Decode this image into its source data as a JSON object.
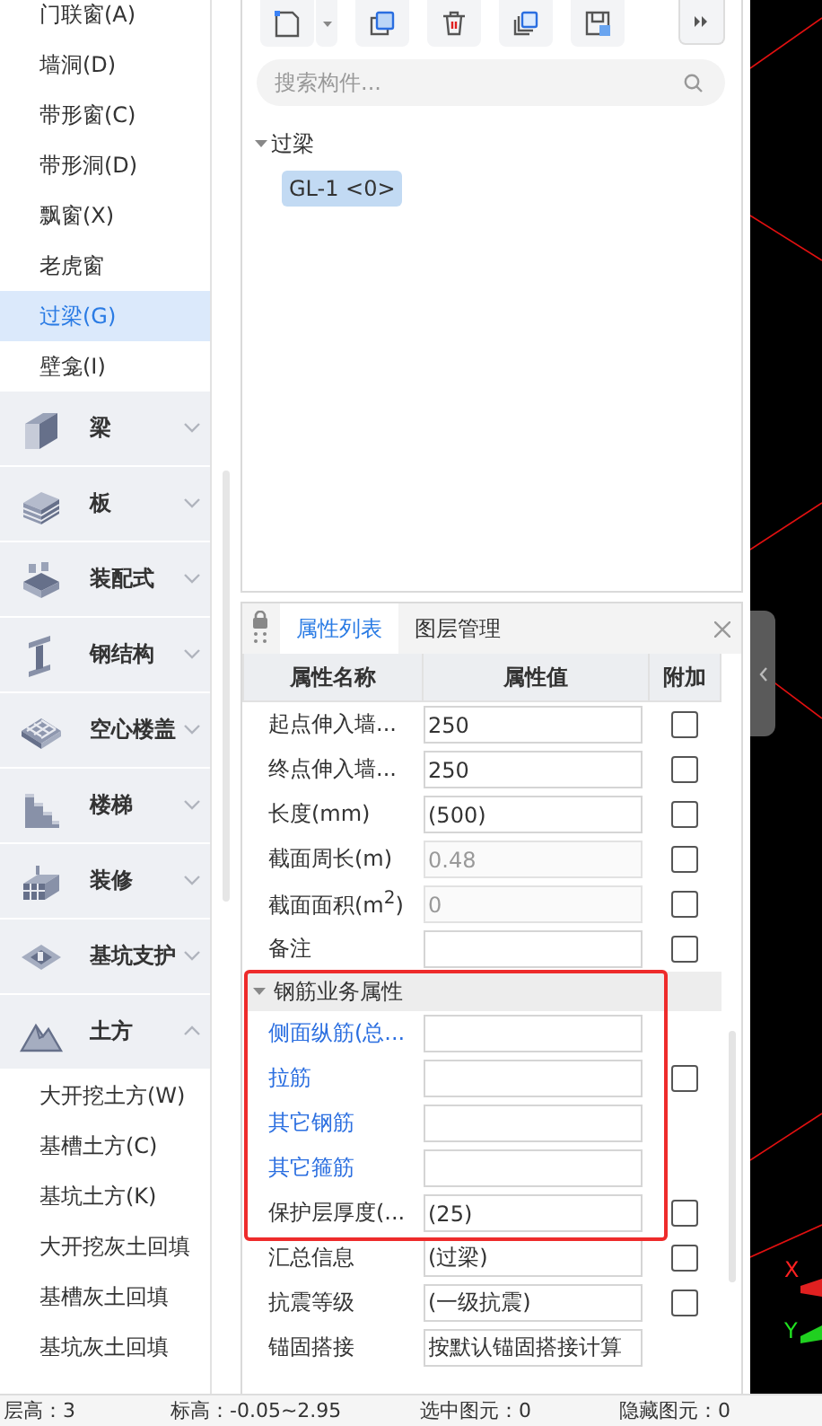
{
  "sidebar": {
    "items": [
      {
        "label": "门联窗(A)",
        "selected": false
      },
      {
        "label": "墙洞(D)",
        "selected": false
      },
      {
        "label": "带形窗(C)",
        "selected": false
      },
      {
        "label": "带形洞(D)",
        "selected": false
      },
      {
        "label": "飘窗(X)",
        "selected": false
      },
      {
        "label": "老虎窗",
        "selected": false
      },
      {
        "label": "过梁(G)",
        "selected": true
      },
      {
        "label": "壁龛(I)",
        "selected": false
      }
    ],
    "categories": [
      {
        "label": "梁",
        "expanded": false
      },
      {
        "label": "板",
        "expanded": false
      },
      {
        "label": "装配式",
        "expanded": false
      },
      {
        "label": "钢结构",
        "expanded": false
      },
      {
        "label": "空心楼盖",
        "expanded": false
      },
      {
        "label": "楼梯",
        "expanded": false
      },
      {
        "label": "装修",
        "expanded": false
      },
      {
        "label": "基坑支护",
        "expanded": false
      },
      {
        "label": "土方",
        "expanded": true,
        "children": [
          "大开挖土方(W)",
          "基槽土方(C)",
          "基坑土方(K)",
          "大开挖灰土回填",
          "基槽灰土回填",
          "基坑灰土回填"
        ]
      }
    ]
  },
  "component_list": {
    "search": {
      "placeholder": "搜索构件..."
    },
    "tree": [
      {
        "label": "过梁",
        "expanded": true,
        "children": [
          {
            "label": "GL-1 <0>",
            "selected": true
          }
        ]
      }
    ]
  },
  "properties": {
    "tabs": [
      {
        "label": "属性列表",
        "selected": true
      },
      {
        "label": "图层管理",
        "selected": false
      }
    ],
    "columns": [
      "属性名称",
      "属性值",
      "附加"
    ],
    "rows": [
      {
        "kind": "row",
        "name": "起点伸入墙...",
        "value": "250",
        "disabled": false,
        "checked": false
      },
      {
        "kind": "row",
        "name": "终点伸入墙...",
        "value": "250",
        "disabled": false,
        "checked": false
      },
      {
        "kind": "row",
        "name": "长度(mm)",
        "value": "(500)",
        "disabled": false,
        "checked": false
      },
      {
        "kind": "row",
        "name": "截面周长(m)",
        "value": "0.48",
        "disabled": true,
        "checked": false
      },
      {
        "kind": "row",
        "name": "截面面积(m$^{2}$)",
        "value": "0",
        "disabled": true,
        "checked": false
      },
      {
        "kind": "row",
        "name": "备注",
        "value": "",
        "disabled": false,
        "checked": false
      },
      {
        "kind": "group",
        "name": "钢筋业务属性",
        "expanded": true,
        "highlighted": true,
        "rows": [
          {
            "name": "侧面纵筋(总...",
            "value": "",
            "link": true
          },
          {
            "name": "拉筋",
            "value": "",
            "link": true,
            "checked": false
          },
          {
            "name": "其它钢筋",
            "value": "",
            "link": true
          },
          {
            "name": "其它箍筋",
            "value": "",
            "link": true
          },
          {
            "name": "保护层厚度(...",
            "value": "(25)",
            "link": false,
            "checked": false
          }
        ]
      },
      {
        "kind": "row",
        "name": "汇总信息",
        "value": "(过梁)",
        "disabled": false,
        "checked": false
      },
      {
        "kind": "row",
        "name": "抗震等级",
        "value": "(一级抗震)",
        "disabled": false,
        "checked": false
      },
      {
        "kind": "row",
        "name": "锚固搭接",
        "value": "按默认锚固搭接计算",
        "disabled": false
      }
    ]
  },
  "canvas": {
    "axis_labels": [
      "X",
      "Y"
    ]
  },
  "status_bar": [
    "层高：3",
    "标高：-0.05~2.95",
    "选中图元：0",
    "隐藏图元：0"
  ]
}
